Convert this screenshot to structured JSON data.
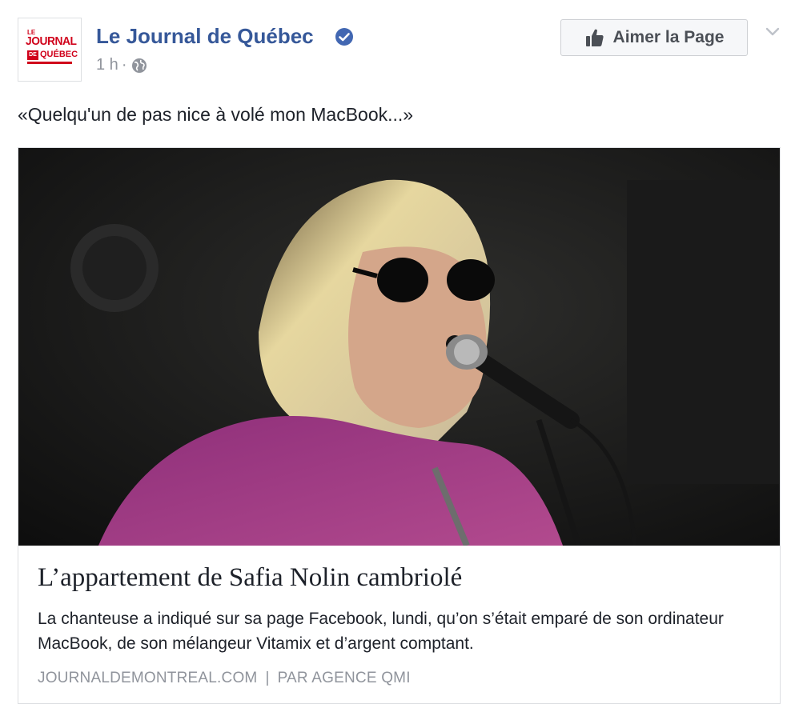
{
  "page": {
    "logo_text": {
      "le": "LE",
      "journal": "JOURNAL",
      "de": "DE",
      "quebec": "QUÉBEC"
    },
    "name": "Le Journal de Québec",
    "verified_icon": "verified-badge-icon",
    "time": "1 h",
    "separator": "·",
    "privacy_icon": "globe-icon"
  },
  "like_button": {
    "label": "Aimer la Page",
    "icon": "thumbs-up-icon"
  },
  "menu": {
    "icon": "chevron-down-icon"
  },
  "post": {
    "text": "«Quelqu'un de pas nice à volé mon MacBook...»"
  },
  "link_card": {
    "image_alt": "photo-of-singer-at-microphone",
    "title": "L’appartement de Safia Nolin cambriolé",
    "description": "La chanteuse a indiqué sur sa page Facebook, lundi, qu’on s’était emparé de son ordinateur MacBook, de son mélangeur Vitamix et d’argent comptant.",
    "domain": "JOURNALDEMONTREAL.COM",
    "source_separator": "|",
    "author": "PAR AGENCE QMI"
  },
  "colors": {
    "link_blue": "#365899",
    "verified_blue": "#4267b2",
    "meta_gray": "#90949c",
    "logo_red": "#d0021b"
  }
}
